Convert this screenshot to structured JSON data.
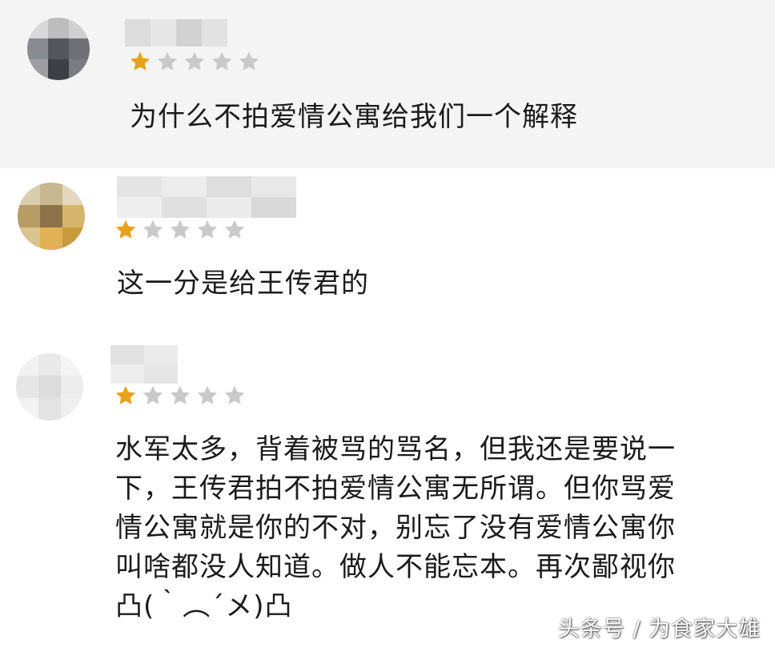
{
  "colors": {
    "star_filled": "#e8a21a",
    "star_empty": "#c9c9c9",
    "text": "#1b1b1b"
  },
  "reviews": [
    {
      "rating": 1,
      "max_rating": 5,
      "text": "为什么不拍爱情公寓给我们一个解释"
    },
    {
      "rating": 1,
      "max_rating": 5,
      "text": "这一分是给王传君的"
    },
    {
      "rating": 1,
      "max_rating": 5,
      "text": "水军太多，背着被骂的骂名，但我还是要说一\n下，王传君拍不拍爱情公寓无所谓。但你骂爱\n情公寓就是你的不对，别忘了没有爱情公寓你\n叫啥都没人知道。做人不能忘本。再次鄙视你\n凸(｀︵´メ)凸"
    }
  ],
  "watermark": "头条号 / 为食家大雄"
}
